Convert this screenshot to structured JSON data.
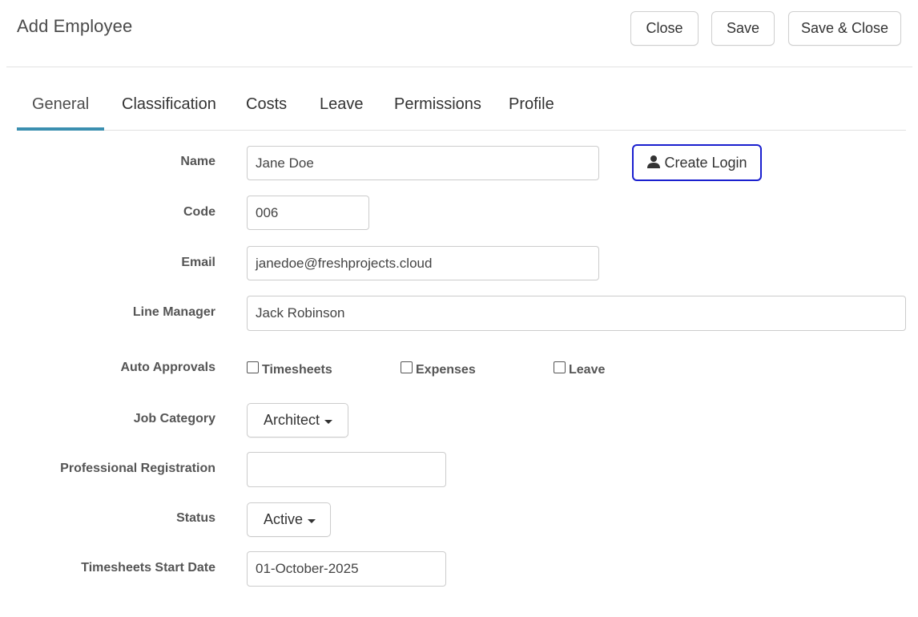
{
  "header": {
    "title": "Add Employee",
    "close_label": "Close",
    "save_label": "Save",
    "save_close_label": "Save & Close"
  },
  "tabs": [
    {
      "label": "General",
      "active": true
    },
    {
      "label": "Classification",
      "active": false
    },
    {
      "label": "Costs",
      "active": false
    },
    {
      "label": "Leave",
      "active": false
    },
    {
      "label": "Permissions",
      "active": false
    },
    {
      "label": "Profile",
      "active": false
    }
  ],
  "form": {
    "name": {
      "label": "Name",
      "value": "Jane Doe"
    },
    "create_login_label": "Create Login",
    "code": {
      "label": "Code",
      "value": "006"
    },
    "email": {
      "label": "Email",
      "value": "janedoe@freshprojects.cloud"
    },
    "line_manager": {
      "label": "Line Manager",
      "value": "Jack Robinson"
    },
    "auto_approvals": {
      "label": "Auto Approvals",
      "options": [
        {
          "label": "Timesheets",
          "checked": false
        },
        {
          "label": "Expenses",
          "checked": false
        },
        {
          "label": "Leave",
          "checked": false
        }
      ]
    },
    "job_category": {
      "label": "Job Category",
      "value": "Architect"
    },
    "professional_registration": {
      "label": "Professional Registration",
      "value": ""
    },
    "status": {
      "label": "Status",
      "value": "Active"
    },
    "timesheets_start_date": {
      "label": "Timesheets Start Date",
      "value": "01-October-2025"
    }
  },
  "colors": {
    "tab_underline": "#3b8fb0",
    "create_login_border": "#1a1fcf"
  },
  "icons": {
    "create_login": "person-icon",
    "dropdown": "caret-down-icon"
  }
}
